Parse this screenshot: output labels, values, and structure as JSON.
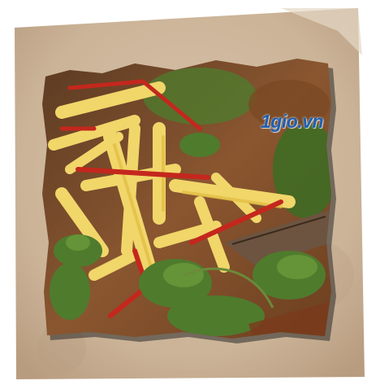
{
  "image": {
    "subject": "mango-salad",
    "watermark_text": "1gio.vn",
    "colors": {
      "paper": "#cdb69e",
      "mango": "#f1d66a",
      "chili": "#c4271d",
      "herb": "#4f7b2d",
      "shadow": "#1a1a1a"
    }
  }
}
